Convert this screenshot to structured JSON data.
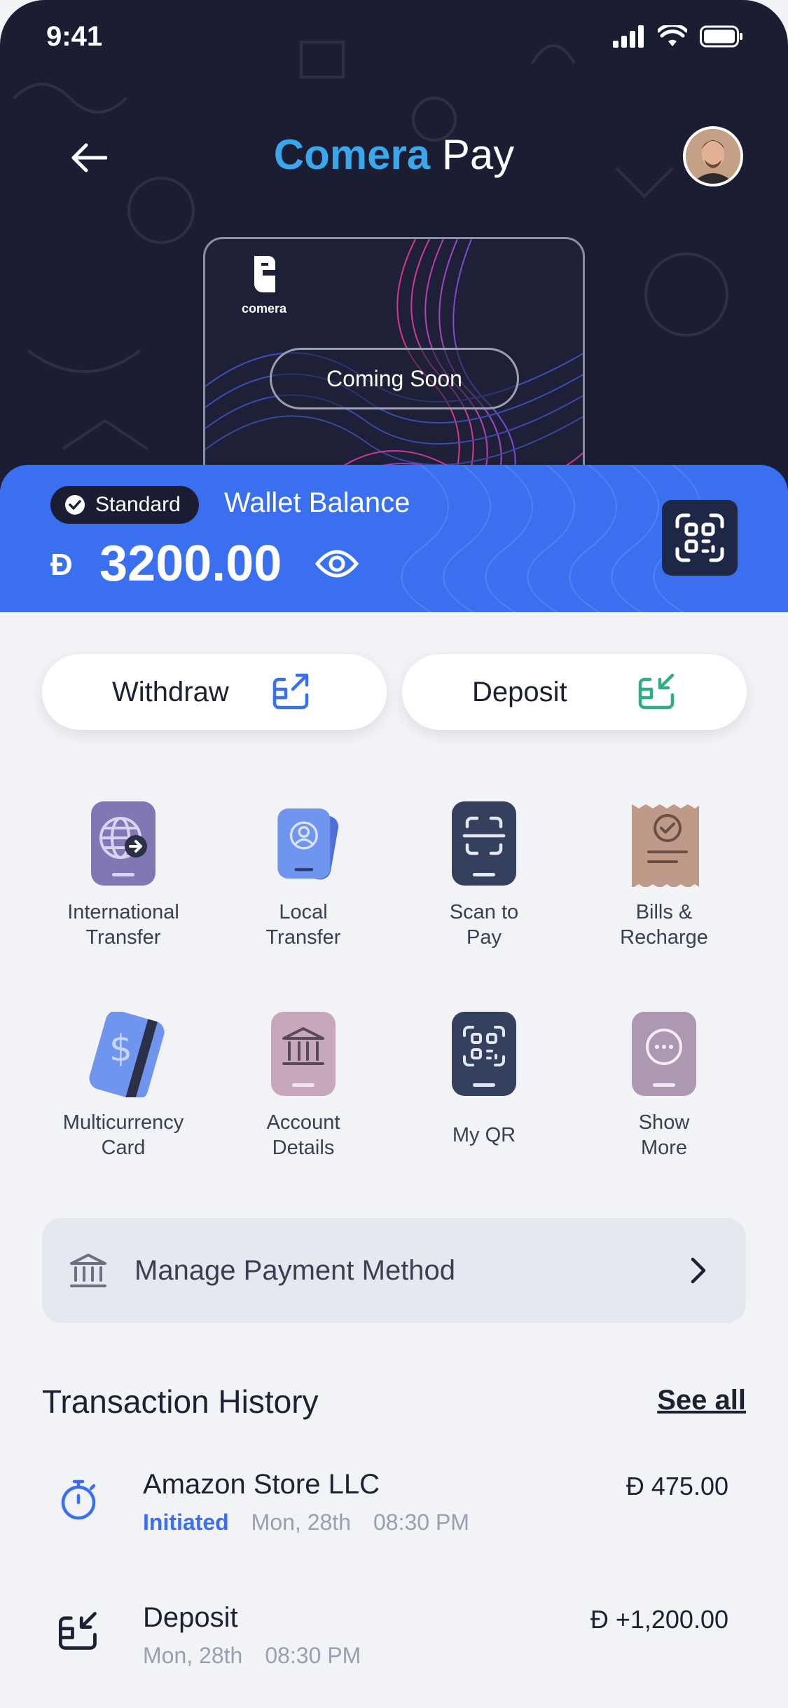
{
  "status_bar": {
    "time": "9:41"
  },
  "header": {
    "title_brand": "Comera",
    "title_rest": "Pay"
  },
  "card": {
    "logo_text": "comera",
    "coming_soon": "Coming Soon"
  },
  "wallet": {
    "tier_badge": "Standard",
    "label": "Wallet Balance",
    "currency_symbol": "Đ",
    "balance": "3200.00"
  },
  "actions": {
    "withdraw": "Withdraw",
    "deposit": "Deposit"
  },
  "services": [
    {
      "label_1": "International",
      "label_2": "Transfer",
      "icon": "globe-transfer-icon",
      "color": "#8277b5"
    },
    {
      "label_1": "Local",
      "label_2": "Transfer",
      "icon": "person-card-icon",
      "color": "#6f95ef"
    },
    {
      "label_1": "Scan to",
      "label_2": "Pay",
      "icon": "scan-frame-icon",
      "color": "#34405e"
    },
    {
      "label_1": "Bills &",
      "label_2": "Recharge",
      "icon": "receipt-icon",
      "color": "#c09a88"
    },
    {
      "label_1": "Multicurrency",
      "label_2": "Card",
      "icon": "dollar-card-icon",
      "color": "#6f95ef"
    },
    {
      "label_1": "Account",
      "label_2": "Details",
      "icon": "bank-icon",
      "color": "#c7a8bb"
    },
    {
      "label_1": "My QR",
      "label_2": "",
      "icon": "qr-icon",
      "color": "#34405e"
    },
    {
      "label_1": "Show",
      "label_2": "More",
      "icon": "more-icon",
      "color": "#ad98b2"
    }
  ],
  "manage_payment": {
    "label": "Manage Payment Method"
  },
  "transactions": {
    "title": "Transaction History",
    "see_all": "See all",
    "items": [
      {
        "name": "Amazon Store LLC",
        "status": "Initiated",
        "date": "Mon, 28th",
        "time": "08:30 PM",
        "amount": "Đ 475.00"
      },
      {
        "name": "Deposit",
        "date": "Mon, 28th",
        "time": "08:30 PM",
        "amount": "Đ +1,200.00"
      }
    ]
  },
  "colors": {
    "primary": "#3a6ff0",
    "brand": "#3aa7ec",
    "header_bg": "#1b1e33",
    "deposit_green": "#2fae86"
  }
}
